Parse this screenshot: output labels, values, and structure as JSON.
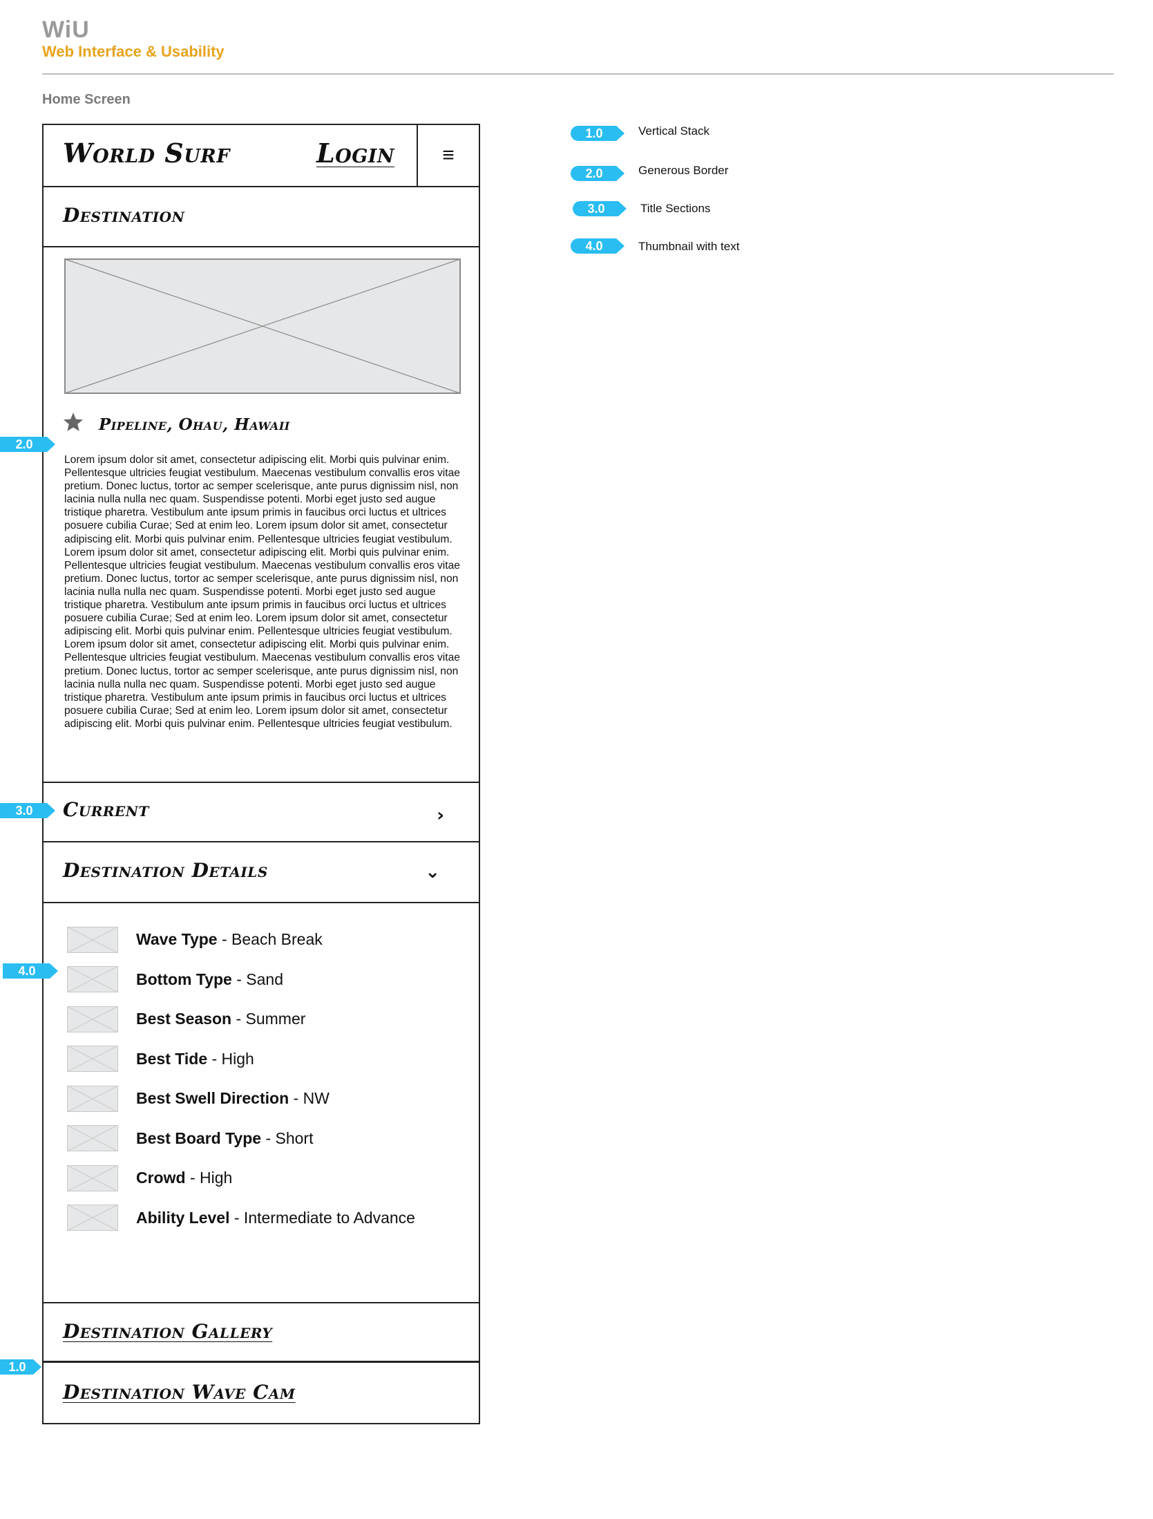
{
  "doc": {
    "brand": "WiU",
    "subtitle": "Web Interface & Usability",
    "screen_label": "Home Screen"
  },
  "header": {
    "logo": "World Surf",
    "login": "Login",
    "menu_icon": "≡"
  },
  "destination": {
    "title": "Destination",
    "location": "Pipeline, Ohau, Hawaii",
    "body_paragraphs": [
      "Lorem ipsum dolor sit amet, consectetur adipiscing elit. Morbi quis pulvinar enim. Pellentesque ultricies feugiat vestibulum. Maecenas vestibulum convallis eros vitae pretium. Donec luctus, tortor ac semper scelerisque, ante purus dignissim nisl, non lacinia nulla nulla nec quam. Suspendisse potenti. Morbi eget justo sed augue tristique pharetra. Vestibulum ante ipsum primis in faucibus orci luctus et ultrices posuere cubilia Curae; Sed at enim leo. Lorem ipsum dolor sit amet, consectetur adipiscing elit. Morbi quis pulvinar enim. Pellentesque ultricies feugiat vestibulum.",
      "Lorem ipsum dolor sit amet, consectetur adipiscing elit. Morbi quis pulvinar enim. Pellentesque ultricies feugiat vestibulum. Maecenas vestibulum convallis eros vitae pretium. Donec luctus, tortor ac semper scelerisque, ante purus dignissim nisl, non lacinia nulla nulla nec quam. Suspendisse potenti. Morbi eget justo sed augue tristique pharetra. Vestibulum ante ipsum primis in faucibus orci luctus et ultrices posuere cubilia Curae; Sed at enim leo. Lorem ipsum dolor sit amet, consectetur adipiscing elit. Morbi quis pulvinar enim. Pellentesque ultricies feugiat vestibulum.",
      "Lorem ipsum dolor sit amet, consectetur adipiscing elit. Morbi quis pulvinar enim. Pellentesque ultricies feugiat vestibulum. Maecenas vestibulum convallis eros vitae pretium. Donec luctus, tortor ac semper scelerisque, ante purus dignissim nisl, non lacinia nulla nulla nec quam. Suspendisse potenti. Morbi eget justo sed augue tristique pharetra. Vestibulum ante ipsum primis in faucibus orci luctus et ultrices posuere cubilia Curae; Sed at enim leo. Lorem ipsum dolor sit amet, consectetur adipiscing elit. Morbi quis pulvinar enim. Pellentesque ultricies feugiat vestibulum."
    ]
  },
  "current": {
    "title": "Current",
    "chevron": "›"
  },
  "details": {
    "title": "Destination Details",
    "chevron": "⌄",
    "items": [
      {
        "label": "Wave Type",
        "value": " - Beach Break"
      },
      {
        "label": "Bottom Type",
        "value": " - Sand"
      },
      {
        "label": "Best Season",
        "value": " - Summer"
      },
      {
        "label": "Best Tide",
        "value": " - High"
      },
      {
        "label": "Best Swell Direction",
        "value": " - NW"
      },
      {
        "label": "Best Board Type",
        "value": " - Short"
      },
      {
        "label": "Crowd",
        "value": " - High"
      },
      {
        "label": "Ability Level",
        "value": " - Intermediate to Advance"
      }
    ]
  },
  "gallery": {
    "title": "Destination Gallery"
  },
  "wavecam": {
    "title": "Destination Wave Cam"
  },
  "annotations": {
    "legend": [
      {
        "tag": "1.0",
        "label": "Vertical Stack"
      },
      {
        "tag": "2.0",
        "label": "Generous Border"
      },
      {
        "tag": "3.0",
        "label": "Title Sections"
      },
      {
        "tag": "4.0",
        "label": "Thumbnail with text"
      }
    ],
    "markers": [
      "2.0",
      "3.0",
      "4.0",
      "1.0"
    ],
    "color": "#29bdf2"
  },
  "colors": {
    "brand_gray": "#9a9a9a",
    "subtitle_orange": "#e8a31c",
    "placeholder_fill": "#e6e7e8"
  }
}
